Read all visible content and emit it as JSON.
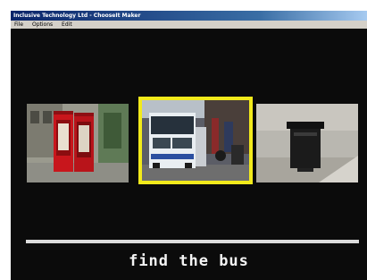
{
  "window": {
    "title": "Inclusive Technology Ltd - ChooseIt Maker"
  },
  "menu": {
    "items": [
      {
        "label": "File"
      },
      {
        "label": "Options"
      },
      {
        "label": "Edit"
      }
    ]
  },
  "choices": [
    {
      "subject": "telephone boxes",
      "selected": false
    },
    {
      "subject": "bus",
      "selected": true
    },
    {
      "subject": "litter bin",
      "selected": false
    }
  ],
  "prompt": {
    "text": "find the bus"
  },
  "colors": {
    "background": "#0b0b0b",
    "highlight": "#f2ea1b",
    "text": "#f4f4f4"
  }
}
